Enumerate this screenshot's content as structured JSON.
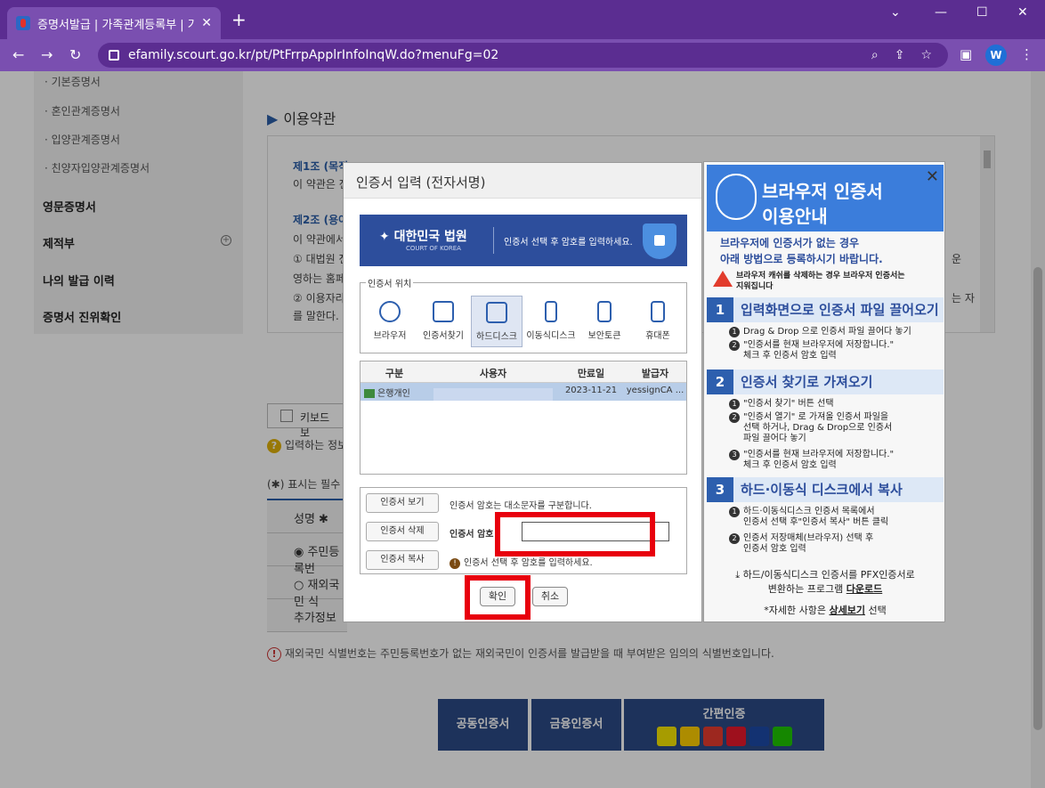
{
  "tab": {
    "title": "증명서발급 | 가족관계등록부 | 가",
    "close": "✕",
    "new": "+"
  },
  "window": {
    "minimize": "—",
    "maximize": "☐",
    "close": "✕"
  },
  "toolbar": {
    "back": "←",
    "forward": "→",
    "reload": "↻",
    "url": "efamily.scourt.go.kr/pt/PtFrrpApplrInfoInqW.do?menuFg=02",
    "avatar": "W"
  },
  "sidebar": {
    "subs": [
      "· 기본증명서",
      "· 혼인관계증명서",
      "· 입양관계증명서",
      "· 친양자입양관계증명서"
    ],
    "mains": [
      "영문증명서",
      "제적부",
      "나의 발급 이력",
      "증명서 진위확인"
    ],
    "plus": "+"
  },
  "content": {
    "section_title": "이용약관",
    "terms": [
      "제1조 (목적",
      "이 약관은 전",
      "제2조 (용어",
      "이 약관에서",
      "① 대법원 전",
      "영하는 홈페",
      "② 이용자라",
      "를 말한다."
    ],
    "terms_right": [
      "운",
      "는 자"
    ],
    "keyboard": "키보드보",
    "info": "입력하는 정보",
    "required": "(✱) 표시는 필수 입",
    "form_rows": [
      "성명 ✱",
      "◉ 주민등록번",
      "○ 재외국민 식",
      "추가정보"
    ],
    "note": "재외국민 식별번호는 주민등록번호가 없는 재외국민이 인증서를 발급받을 때 부여받은 임의의 식별번호입니다.",
    "btn_public": "공동인증서",
    "btn_finance": "금융인증서",
    "btn_easy": "간편인증",
    "easy_logos": [
      {
        "name": "kakao",
        "color": "#f7e600"
      },
      {
        "name": "kb",
        "color": "#ffce00"
      },
      {
        "name": "payco",
        "color": "#e73c2f"
      },
      {
        "name": "pass",
        "color": "#e9192b"
      },
      {
        "name": "samsung-pass",
        "color": "#1d4aa8"
      },
      {
        "name": "naver",
        "color": "#1fc700"
      }
    ]
  },
  "dialog": {
    "title": "인증서 입력 (전자서명)",
    "banner_logo": "대한민국 법원",
    "banner_logo_sub": "COURT OF KOREA",
    "banner_msg": "인증서 선택 후 암호를 입력하세요.",
    "location_caption": "인증서 위치",
    "locations": [
      "브라우저",
      "인증서찾기",
      "하드디스크",
      "이동식디스크",
      "보안토큰",
      "휴대폰"
    ],
    "cert_headers": [
      "구분",
      "사용자",
      "만료일",
      "발급자"
    ],
    "cert_row": {
      "type": "은행개인",
      "user": "",
      "expiry": "2023-11-21",
      "issuer": "yessignCA ..."
    },
    "btn_view": "인증서 보기",
    "btn_delete": "인증서 삭제",
    "btn_copy": "인증서 복사",
    "case_note": "인증서 암호는 대소문자를 구분합니다.",
    "pw_label": "인증서 암호",
    "pw_value": "",
    "select_note": "인증서 선택 후 암호를 입력하세요.",
    "ok": "확인",
    "cancel": "취소"
  },
  "guide": {
    "title1": "브라우저 인증서",
    "title2": "이용안내",
    "close": "✕",
    "sub1": "브라우저에 인증서가 없는 경우",
    "sub2": "아래 방법으로 등록하시기 바랍니다.",
    "warn1": "브라우저 캐쉬를 삭제하는 경우 브라우저 인증서는",
    "warn2": "지워집니다",
    "steps": [
      {
        "num": "1",
        "title": "입력화면으로 인증서 파일 끌어오기",
        "items": [
          {
            "b": "1",
            "lines": [
              "Drag & Drop 으로 인증서 파일 끌어다 놓기"
            ]
          },
          {
            "b": "2",
            "lines": [
              "\"인증서를 현재 브라우저에 저장합니다.\"",
              "체크 후 인증서 암호 입력"
            ]
          }
        ]
      },
      {
        "num": "2",
        "title": "인증서 찾기로 가져오기",
        "items": [
          {
            "b": "1",
            "lines": [
              "\"인증서 찾기\" 버튼 선택"
            ]
          },
          {
            "b": "2",
            "lines": [
              "\"인증서 열기\" 로 가져올 인증서 파일을",
              "선택 하거나, Drag & Drop으로 인증서",
              "파일 끌어다 놓기"
            ]
          },
          {
            "b": "3",
            "lines": [
              "\"인증서를 현재 브라우저에 저장합니다.\"",
              "체크 후 인증서 암호 입력"
            ]
          }
        ]
      },
      {
        "num": "3",
        "title": "하드·이동식 디스크에서 복사",
        "items": [
          {
            "b": "1",
            "lines": [
              "하드·이동식디스크 인증서 목록에서",
              "인증서 선택 후\"인증서 복사\" 버튼 클릭"
            ]
          },
          {
            "b": "2",
            "lines": [
              "인증서 저장매체(브라우저) 선택 후",
              "인증서 암호 입력"
            ]
          }
        ]
      }
    ],
    "pfx1": "하드/이동식디스크 인증서를 PFX인증서로",
    "pfx2": "변환하는 프로그램",
    "download": "다운로드",
    "detail_pre": "*자세한 사항은",
    "detail_link": "상세보기",
    "detail_post": "선택"
  }
}
